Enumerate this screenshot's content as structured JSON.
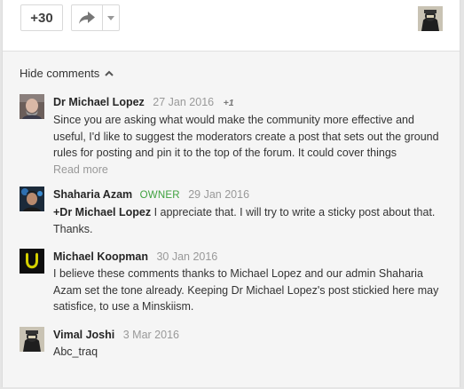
{
  "actions": {
    "plus_label": "+30",
    "share_icon": "share-arrow-icon",
    "dropdown_icon": "caret-down-icon"
  },
  "comments_toggle": {
    "label": "Hide comments",
    "icon": "chevron-up-icon"
  },
  "comments": [
    {
      "author": "Dr Michael Lopez",
      "date": "27 Jan 2016",
      "plus": "+1",
      "text": "Since you are asking what would make the community more effective and useful, I'd like to suggest the moderators create a post that sets out the ground rules for posting and pin it to the top of the forum. It could cover things",
      "read_more": "Read more"
    },
    {
      "author": "Shaharia Azam",
      "badge": "OWNER",
      "date": "29 Jan 2016",
      "mention": "+Dr Michael Lopez",
      "text": " I appreciate that. I will try to write a sticky post about that. Thanks."
    },
    {
      "author": "Michael Koopman",
      "date": "30 Jan 2016",
      "text": "I believe these comments thanks to Michael Lopez and our admin Shaharia Azam set the tone already. Keeping Dr Michael Lopez's post stickied here may satisfice, to use a Minskiism."
    },
    {
      "author": "Vimal Joshi",
      "date": "3 Mar 2016",
      "text": "Abc_traq"
    }
  ],
  "colors": {
    "owner_badge": "#3fa13f",
    "date_text": "#999999",
    "comments_bg": "#f5f5f5"
  }
}
